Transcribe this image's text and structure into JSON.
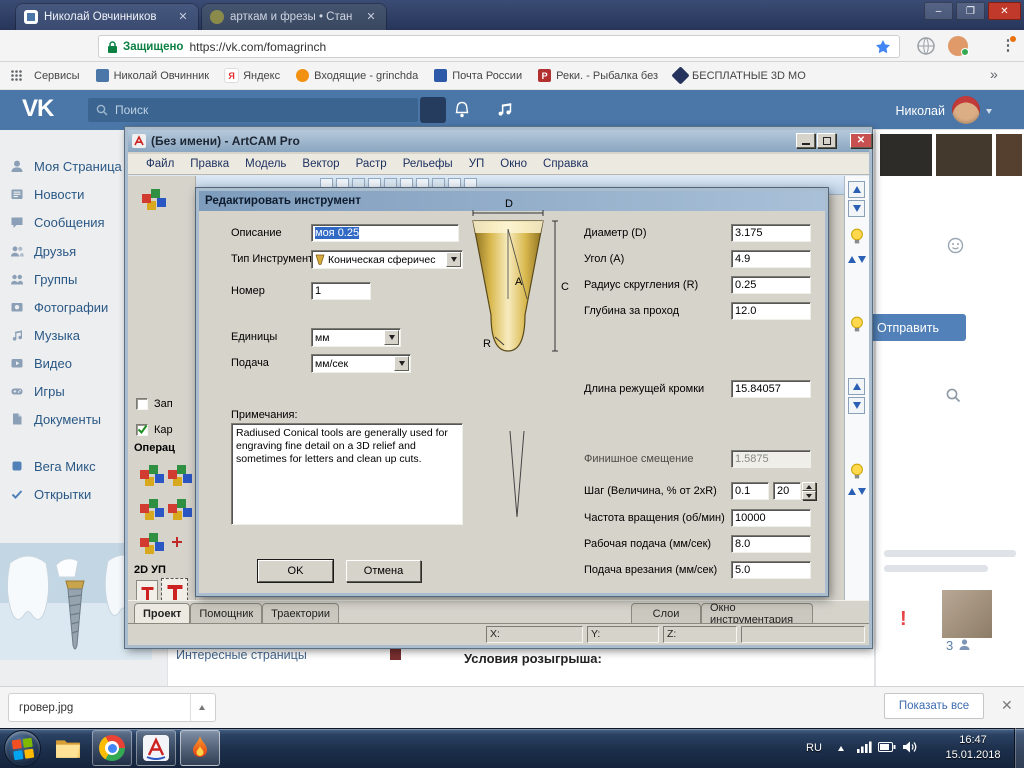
{
  "glyphs": {
    "close_x": "✕",
    "minimize": "–",
    "maximize": "❐",
    "overflow": "»",
    "menu_dots": "⋮",
    "exclaim": "!"
  },
  "browser": {
    "tabs": [
      {
        "title": "Николай Овчинников"
      },
      {
        "title": "арткам и фрезы • Стан"
      }
    ],
    "address_bar": {
      "secure_label": "Защищено",
      "url": "https://vk.com/fomagrinch"
    },
    "bookmarks": [
      {
        "label": "Сервисы"
      },
      {
        "label": "Николай Овчинник"
      },
      {
        "label": "Яндекс"
      },
      {
        "label": "Входящие - grinchda"
      },
      {
        "label": "Почта России"
      },
      {
        "label": "Реки. - Рыбалка без"
      },
      {
        "label": "БЕСПЛАТНЫЕ 3D МО"
      }
    ],
    "yandex_letter": "Я",
    "rf_letter": "Р"
  },
  "vk": {
    "logo": "VK",
    "search_placeholder": "Поиск",
    "username": "Николай",
    "sidebar": [
      {
        "label": "Моя Страница"
      },
      {
        "label": "Новости"
      },
      {
        "label": "Сообщения"
      },
      {
        "label": "Друзья"
      },
      {
        "label": "Группы"
      },
      {
        "label": "Фотографии"
      },
      {
        "label": "Музыка"
      },
      {
        "label": "Видео"
      },
      {
        "label": "Игры"
      },
      {
        "label": "Документы"
      },
      {
        "label": "Вега Микс"
      },
      {
        "label": "Открытки"
      }
    ],
    "send_button": "Отправить",
    "interesting_pages": "Интересные страницы",
    "contest_heading": "Условия розыгрыша:",
    "viewers_count": "3"
  },
  "artcam": {
    "window_title": "(Без имени) - ArtCAM Pro",
    "menu": [
      "Файл",
      "Правка",
      "Модель",
      "Вектор",
      "Растр",
      "Рельефы",
      "УП",
      "Окно",
      "Справка"
    ],
    "panel": {
      "record_checkbox": "Зап",
      "frame_checkbox": "Кар",
      "operations_label": "Операц",
      "up2d_label": "2D УП"
    },
    "bottom_tabs": [
      "Проект",
      "Помощник",
      "Траектории"
    ],
    "right_tabs": [
      "Слои",
      "Окно инструментария"
    ],
    "status_labels": [
      "X:",
      "Y:",
      "Z:"
    ]
  },
  "dialog": {
    "title": "Редактировать инструмент",
    "description_label": "Описание",
    "description_value": "моя 0.25",
    "tool_type_label": "Тип Инструмента",
    "tool_type_value": "Коническая сферичес",
    "number_label": "Номер",
    "number_value": "1",
    "units_label": "Единицы",
    "units_value": "мм",
    "feed_units_label": "Подача",
    "feed_units_value": "мм/сек",
    "notes_label": "Примечания:",
    "notes_text": "Radiused Conical tools are generally used for engraving fine detail on a 3D relief and sometimes for letters and clean up cuts.",
    "diagram_labels": {
      "diameter": "D",
      "angle": "A",
      "length": "C",
      "radius": "R"
    },
    "params": [
      {
        "label": "Диаметр (D)",
        "value": "3.175"
      },
      {
        "label": "Угол (A)",
        "value": "4.9"
      },
      {
        "label": "Радиус скругления (R)",
        "value": "0.25"
      },
      {
        "label": "Глубина за проход",
        "value": "12.0"
      },
      {
        "label": "Длина режущей кромки",
        "value": "15.84057"
      },
      {
        "label": "Финишное смещение",
        "value": "1.5875"
      },
      {
        "label": "Шаг (Величина, % от 2xR)",
        "value": "0.1",
        "value2": "20"
      },
      {
        "label": "Частота вращения (об/мин)",
        "value": "10000"
      },
      {
        "label": "Рабочая подача (мм/сек)",
        "value": "8.0"
      },
      {
        "label": "Подача врезания (мм/сек)",
        "value": "5.0"
      }
    ],
    "ok_button": "OK",
    "cancel_button": "Отмена"
  },
  "downloads": {
    "filename": "гровер.jpg",
    "show_all_button": "Показать все"
  },
  "taskbar": {
    "language": "RU",
    "time": "16:47",
    "date": "15.01.2018"
  }
}
